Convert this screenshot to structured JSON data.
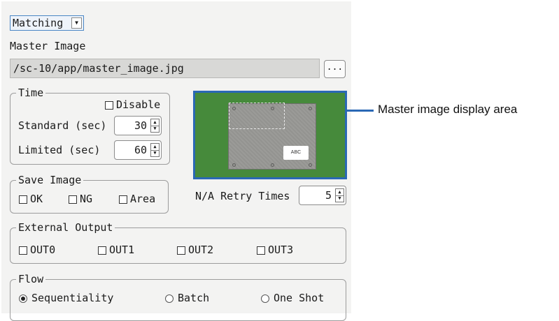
{
  "mode": {
    "selected": "Matching"
  },
  "master_image": {
    "label": "Master Image",
    "path": "/sc-10/app/master_image.jpg",
    "browse_label": "..."
  },
  "time": {
    "title": "Time",
    "disable_label": "Disable",
    "disable_checked": false,
    "standard_label": "Standard (sec)",
    "standard_value": "30",
    "limited_label": "Limited (sec)",
    "limited_value": "60"
  },
  "save_image": {
    "title": "Save Image",
    "options": [
      {
        "label": "OK",
        "checked": false
      },
      {
        "label": "NG",
        "checked": false
      },
      {
        "label": "Area",
        "checked": false
      }
    ]
  },
  "retry": {
    "label": "N/A Retry Times",
    "value": "5"
  },
  "preview": {
    "chip_text": "ABC",
    "background_color": "#468a3b",
    "border_color": "#2a68b5"
  },
  "callout": {
    "text": "Master image display area"
  },
  "external_output": {
    "title": "External Output",
    "options": [
      {
        "label": "OUT0",
        "checked": false
      },
      {
        "label": "OUT1",
        "checked": false
      },
      {
        "label": "OUT2",
        "checked": false
      },
      {
        "label": "OUT3",
        "checked": false
      }
    ]
  },
  "flow": {
    "title": "Flow",
    "options": [
      {
        "label": "Sequentiality",
        "selected": true
      },
      {
        "label": "Batch",
        "selected": false
      },
      {
        "label": "One Shot",
        "selected": false
      }
    ]
  }
}
